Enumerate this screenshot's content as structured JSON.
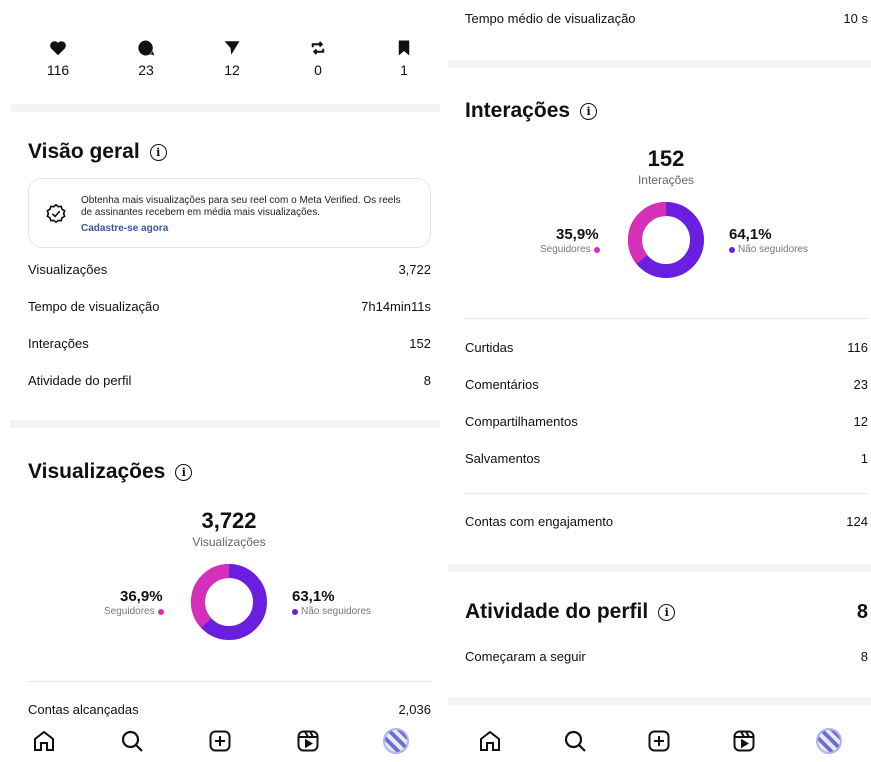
{
  "left": {
    "stats": [
      {
        "icon": "heart-icon",
        "value": "116"
      },
      {
        "icon": "comment-icon",
        "value": "23"
      },
      {
        "icon": "send-icon",
        "value": "12"
      },
      {
        "icon": "repost-icon",
        "value": "0"
      },
      {
        "icon": "bookmark-icon",
        "value": "1"
      }
    ],
    "overview": {
      "title": "Visão geral",
      "card_text": "Obtenha mais visualizações para seu reel com o Meta Verified. Os reels de assinantes recebem em média mais visualizações.",
      "card_link": "Cadastre-se agora",
      "rows": [
        {
          "label": "Visualizações",
          "value": "3,722"
        },
        {
          "label": "Tempo de visualização",
          "value": "7h14min11s"
        },
        {
          "label": "Interações",
          "value": "152"
        },
        {
          "label": "Atividade do perfil",
          "value": "8"
        }
      ]
    },
    "views": {
      "title": "Visualizações",
      "total": "3,722",
      "total_label": "Visualizações",
      "followers_pct": "36,9%",
      "followers_label": "Seguidores",
      "non_followers_pct": "63,1%",
      "non_followers_label": "Não seguidores",
      "followers_fraction": 0.369,
      "reach_label": "Contas alcançadas",
      "reach_value": "2,036"
    }
  },
  "right": {
    "top_row": {
      "label": "Tempo médio de visualização",
      "value": "10 s"
    },
    "interactions": {
      "title": "Interações",
      "total": "152",
      "total_label": "Interações",
      "followers_pct": "35,9%",
      "followers_label": "Seguidores",
      "non_followers_pct": "64,1%",
      "non_followers_label": "Não seguidores",
      "followers_fraction": 0.359,
      "rows": [
        {
          "label": "Curtidas",
          "value": "116"
        },
        {
          "label": "Comentários",
          "value": "23"
        },
        {
          "label": "Compartilhamentos",
          "value": "12"
        },
        {
          "label": "Salvamentos",
          "value": "1"
        }
      ],
      "engaged_label": "Contas com engajamento",
      "engaged_value": "124"
    },
    "profile_activity": {
      "title": "Atividade do perfil",
      "total": "8",
      "row_label": "Começaram a seguir",
      "row_value": "8"
    }
  },
  "nav": [
    "home-icon",
    "search-icon",
    "create-icon",
    "reels-icon",
    "profile-avatar"
  ],
  "colors": {
    "followers": "#d62fb8",
    "non_followers": "#6a1fe0",
    "link": "#385898",
    "separator": "#f3f4f6"
  }
}
